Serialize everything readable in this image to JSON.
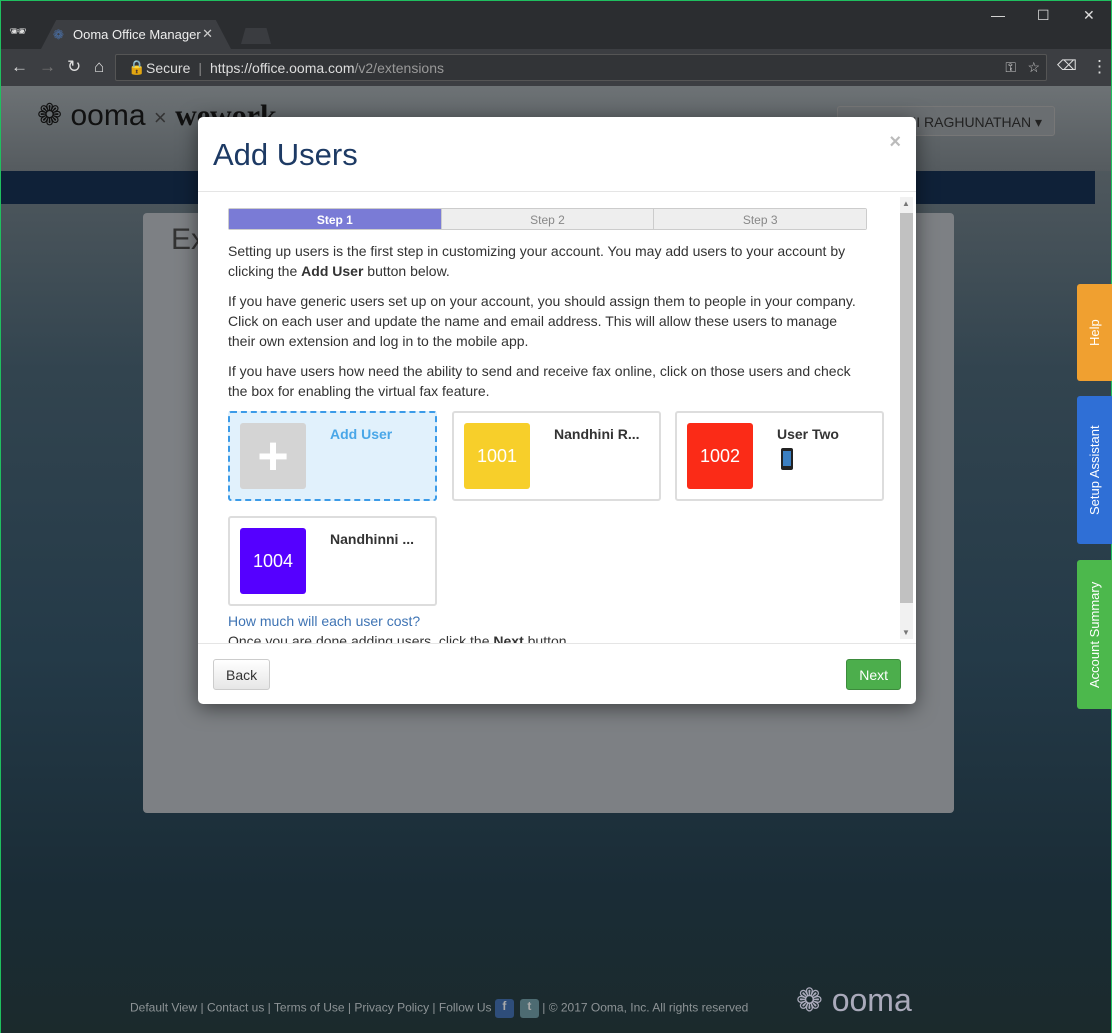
{
  "browser": {
    "tab_title": "Ooma Office Manager",
    "secure_label": "Secure",
    "url_scheme": "https://",
    "url_host": "office.ooma.com",
    "url_path": "/v2/extensions"
  },
  "header": {
    "logo": "ooma",
    "partner_logo": "wework",
    "times": "×",
    "user_menu": "NANDHINI RAGHUNATHAN"
  },
  "background": {
    "page_title": "Ex"
  },
  "side_tabs": [
    {
      "label": "Help",
      "color": "#f0a030"
    },
    {
      "label": "Setup Assistant",
      "color": "#2f6fd6"
    },
    {
      "label": "Account Summary",
      "color": "#4cb84c"
    }
  ],
  "modal": {
    "title": "Add Users",
    "close": "×",
    "steps": [
      "Step 1",
      "Step 2",
      "Step 3"
    ],
    "active_step": 1,
    "p1_a": "Setting up users is the first step in customizing your account. You may add users to your account by clicking the ",
    "p1_b": "Add User",
    "p1_c": " button below.",
    "p2": "If you have generic users set up on your account, you should assign them to people in your company. Click on each user and update the name and email address. This will allow these users to manage their own extension and log in to the mobile app.",
    "p3": "If you have users how need the ability to send and receive fax online, click on those users and check the box for enabling the virtual fax feature.",
    "add_user": "Add User",
    "users": [
      {
        "ext": "1001",
        "name": "Nandhini R...",
        "color": "#f7cf2a"
      },
      {
        "ext": "1002",
        "name": "User Two",
        "color": "#fb2b17",
        "mobile": true
      },
      {
        "ext": "1004",
        "name": "Nandhinni ...",
        "color": "#5500ff"
      }
    ],
    "cost_link": "How much will each user cost?",
    "p4_a": "Once you are done adding users, click the ",
    "p4_b": "Next",
    "p4_c": " button.",
    "back": "Back",
    "next": "Next"
  },
  "footer": {
    "links": [
      "Default View",
      "Contact us",
      "Terms of Use",
      "Privacy Policy",
      "Follow Us"
    ],
    "copyright": "| © 2017 Ooma, Inc. All rights reserved",
    "logo": "ooma"
  }
}
